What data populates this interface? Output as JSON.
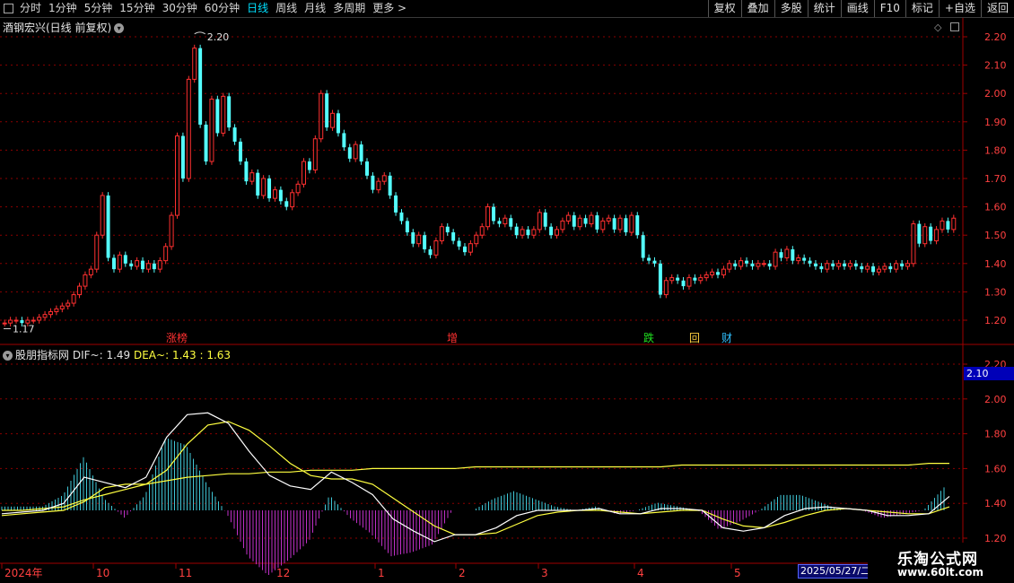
{
  "toolbar": {
    "periods": [
      "分时",
      "1分钟",
      "5分钟",
      "15分钟",
      "30分钟",
      "60分钟",
      "日线",
      "周线",
      "月线",
      "多周期",
      "更多"
    ],
    "active_period": "日线",
    "more_arrow": ">",
    "buttons": [
      "复权",
      "叠加",
      "多股",
      "统计",
      "画线",
      "F10",
      "标记",
      "+自选",
      "返回"
    ]
  },
  "main_panel": {
    "title": "酒钢宏兴(日线 前复权)",
    "high_label": "2.20",
    "low_label": "1.17",
    "events": [
      {
        "text": "涨榜",
        "color": "#ff3030"
      },
      {
        "text": "增",
        "color": "#ff3030"
      },
      {
        "text": "跌",
        "color": "#20e020"
      },
      {
        "text": "回",
        "color": "#ffd040"
      },
      {
        "text": "财",
        "color": "#30c0ff"
      }
    ]
  },
  "indicator_panel": {
    "title_prefix": "股朋指标网",
    "dif_label": "DIF~: ",
    "dif_value": "1.49",
    "dea_label": "DEA~: ",
    "dea_value": "1.43",
    "third_value": "1.63",
    "current_value": "2.10"
  },
  "chart_data": {
    "type": "candlestick",
    "price_axis": {
      "ticks": [
        "2.20",
        "2.10",
        "2.00",
        "1.90",
        "1.80",
        "1.70",
        "1.60",
        "1.50",
        "1.40",
        "1.30",
        "1.20"
      ],
      "range": [
        1.17,
        2.22
      ]
    },
    "indicator_axis": {
      "ticks": [
        "2.20",
        "2.00",
        "1.80",
        "1.60",
        "1.40",
        "1.20"
      ]
    },
    "x_axis": {
      "labels": [
        "2024年",
        "10",
        "11",
        "12",
        "1",
        "2",
        "3",
        "4",
        "5"
      ]
    },
    "selected_date": "2025/05/27/二",
    "candles": [
      {
        "o": 1.19,
        "c": 1.19
      },
      {
        "o": 1.19,
        "c": 1.2
      },
      {
        "o": 1.2,
        "c": 1.2
      },
      {
        "o": 1.2,
        "c": 1.19
      },
      {
        "o": 1.19,
        "c": 1.2
      },
      {
        "o": 1.2,
        "c": 1.2
      },
      {
        "o": 1.2,
        "c": 1.21
      },
      {
        "o": 1.21,
        "c": 1.22
      },
      {
        "o": 1.22,
        "c": 1.23
      },
      {
        "o": 1.23,
        "c": 1.24
      },
      {
        "o": 1.24,
        "c": 1.25
      },
      {
        "o": 1.25,
        "c": 1.26
      },
      {
        "o": 1.26,
        "c": 1.29
      },
      {
        "o": 1.29,
        "c": 1.32
      },
      {
        "o": 1.32,
        "c": 1.36
      },
      {
        "o": 1.36,
        "c": 1.38
      },
      {
        "o": 1.38,
        "c": 1.5
      },
      {
        "o": 1.5,
        "c": 1.64
      },
      {
        "o": 1.64,
        "c": 1.42
      },
      {
        "o": 1.42,
        "c": 1.38
      },
      {
        "o": 1.38,
        "c": 1.43
      },
      {
        "o": 1.43,
        "c": 1.4
      },
      {
        "o": 1.4,
        "c": 1.39
      },
      {
        "o": 1.39,
        "c": 1.41
      },
      {
        "o": 1.41,
        "c": 1.38
      },
      {
        "o": 1.38,
        "c": 1.4
      },
      {
        "o": 1.4,
        "c": 1.38
      },
      {
        "o": 1.38,
        "c": 1.41
      },
      {
        "o": 1.41,
        "c": 1.46
      },
      {
        "o": 1.46,
        "c": 1.57
      },
      {
        "o": 1.57,
        "c": 1.85
      },
      {
        "o": 1.85,
        "c": 1.7
      },
      {
        "o": 1.7,
        "c": 2.05
      },
      {
        "o": 2.05,
        "c": 2.16
      },
      {
        "o": 2.16,
        "c": 1.89
      },
      {
        "o": 1.89,
        "c": 1.76
      },
      {
        "o": 1.76,
        "c": 1.98
      },
      {
        "o": 1.98,
        "c": 1.86
      },
      {
        "o": 1.86,
        "c": 1.99
      },
      {
        "o": 1.99,
        "c": 1.88
      },
      {
        "o": 1.88,
        "c": 1.83
      },
      {
        "o": 1.83,
        "c": 1.76
      },
      {
        "o": 1.76,
        "c": 1.69
      },
      {
        "o": 1.69,
        "c": 1.72
      },
      {
        "o": 1.72,
        "c": 1.64
      },
      {
        "o": 1.64,
        "c": 1.7
      },
      {
        "o": 1.7,
        "c": 1.63
      },
      {
        "o": 1.63,
        "c": 1.66
      },
      {
        "o": 1.66,
        "c": 1.62
      },
      {
        "o": 1.62,
        "c": 1.6
      },
      {
        "o": 1.6,
        "c": 1.65
      },
      {
        "o": 1.65,
        "c": 1.68
      },
      {
        "o": 1.68,
        "c": 1.76
      },
      {
        "o": 1.76,
        "c": 1.73
      },
      {
        "o": 1.73,
        "c": 1.84
      },
      {
        "o": 1.84,
        "c": 2.0
      },
      {
        "o": 2.0,
        "c": 1.88
      },
      {
        "o": 1.88,
        "c": 1.93
      },
      {
        "o": 1.93,
        "c": 1.86
      },
      {
        "o": 1.86,
        "c": 1.81
      },
      {
        "o": 1.81,
        "c": 1.77
      },
      {
        "o": 1.77,
        "c": 1.82
      },
      {
        "o": 1.82,
        "c": 1.76
      },
      {
        "o": 1.76,
        "c": 1.71
      },
      {
        "o": 1.71,
        "c": 1.66
      },
      {
        "o": 1.66,
        "c": 1.69
      },
      {
        "o": 1.69,
        "c": 1.71
      },
      {
        "o": 1.71,
        "c": 1.64
      },
      {
        "o": 1.64,
        "c": 1.58
      },
      {
        "o": 1.58,
        "c": 1.55
      },
      {
        "o": 1.55,
        "c": 1.51
      },
      {
        "o": 1.51,
        "c": 1.47
      },
      {
        "o": 1.47,
        "c": 1.5
      },
      {
        "o": 1.5,
        "c": 1.45
      },
      {
        "o": 1.45,
        "c": 1.43
      },
      {
        "o": 1.43,
        "c": 1.48
      },
      {
        "o": 1.48,
        "c": 1.53
      },
      {
        "o": 1.53,
        "c": 1.51
      },
      {
        "o": 1.51,
        "c": 1.48
      },
      {
        "o": 1.48,
        "c": 1.46
      },
      {
        "o": 1.46,
        "c": 1.44
      },
      {
        "o": 1.44,
        "c": 1.47
      },
      {
        "o": 1.47,
        "c": 1.5
      },
      {
        "o": 1.5,
        "c": 1.53
      },
      {
        "o": 1.53,
        "c": 1.6
      },
      {
        "o": 1.6,
        "c": 1.55
      },
      {
        "o": 1.55,
        "c": 1.54
      },
      {
        "o": 1.54,
        "c": 1.56
      },
      {
        "o": 1.56,
        "c": 1.53
      },
      {
        "o": 1.53,
        "c": 1.5
      },
      {
        "o": 1.5,
        "c": 1.52
      },
      {
        "o": 1.52,
        "c": 1.5
      },
      {
        "o": 1.5,
        "c": 1.52
      },
      {
        "o": 1.52,
        "c": 1.58
      },
      {
        "o": 1.58,
        "c": 1.53
      },
      {
        "o": 1.53,
        "c": 1.5
      },
      {
        "o": 1.5,
        "c": 1.52
      },
      {
        "o": 1.52,
        "c": 1.55
      },
      {
        "o": 1.55,
        "c": 1.57
      },
      {
        "o": 1.57,
        "c": 1.53
      },
      {
        "o": 1.53,
        "c": 1.56
      },
      {
        "o": 1.56,
        "c": 1.54
      },
      {
        "o": 1.54,
        "c": 1.57
      },
      {
        "o": 1.57,
        "c": 1.52
      },
      {
        "o": 1.52,
        "c": 1.55
      },
      {
        "o": 1.55,
        "c": 1.56
      },
      {
        "o": 1.56,
        "c": 1.52
      },
      {
        "o": 1.52,
        "c": 1.56
      },
      {
        "o": 1.56,
        "c": 1.51
      },
      {
        "o": 1.51,
        "c": 1.57
      },
      {
        "o": 1.57,
        "c": 1.5
      },
      {
        "o": 1.5,
        "c": 1.42
      },
      {
        "o": 1.42,
        "c": 1.41
      },
      {
        "o": 1.41,
        "c": 1.4
      },
      {
        "o": 1.4,
        "c": 1.29
      },
      {
        "o": 1.29,
        "c": 1.34
      },
      {
        "o": 1.34,
        "c": 1.35
      },
      {
        "o": 1.35,
        "c": 1.34
      },
      {
        "o": 1.34,
        "c": 1.32
      },
      {
        "o": 1.32,
        "c": 1.35
      },
      {
        "o": 1.35,
        "c": 1.34
      },
      {
        "o": 1.34,
        "c": 1.35
      },
      {
        "o": 1.35,
        "c": 1.36
      },
      {
        "o": 1.36,
        "c": 1.37
      },
      {
        "o": 1.37,
        "c": 1.36
      },
      {
        "o": 1.36,
        "c": 1.38
      },
      {
        "o": 1.38,
        "c": 1.4
      },
      {
        "o": 1.4,
        "c": 1.39
      },
      {
        "o": 1.39,
        "c": 1.41
      },
      {
        "o": 1.41,
        "c": 1.4
      },
      {
        "o": 1.4,
        "c": 1.39
      },
      {
        "o": 1.39,
        "c": 1.4
      },
      {
        "o": 1.4,
        "c": 1.4
      },
      {
        "o": 1.4,
        "c": 1.39
      },
      {
        "o": 1.39,
        "c": 1.44
      },
      {
        "o": 1.44,
        "c": 1.42
      },
      {
        "o": 1.42,
        "c": 1.45
      },
      {
        "o": 1.45,
        "c": 1.41
      },
      {
        "o": 1.41,
        "c": 1.42
      },
      {
        "o": 1.42,
        "c": 1.41
      },
      {
        "o": 1.41,
        "c": 1.4
      },
      {
        "o": 1.4,
        "c": 1.39
      },
      {
        "o": 1.39,
        "c": 1.38
      },
      {
        "o": 1.38,
        "c": 1.4
      },
      {
        "o": 1.4,
        "c": 1.39
      },
      {
        "o": 1.39,
        "c": 1.4
      },
      {
        "o": 1.4,
        "c": 1.39
      },
      {
        "o": 1.39,
        "c": 1.4
      },
      {
        "o": 1.4,
        "c": 1.39
      },
      {
        "o": 1.39,
        "c": 1.38
      },
      {
        "o": 1.38,
        "c": 1.39
      },
      {
        "o": 1.39,
        "c": 1.37
      },
      {
        "o": 1.37,
        "c": 1.38
      },
      {
        "o": 1.38,
        "c": 1.39
      },
      {
        "o": 1.39,
        "c": 1.38
      },
      {
        "o": 1.38,
        "c": 1.4
      },
      {
        "o": 1.4,
        "c": 1.39
      },
      {
        "o": 1.39,
        "c": 1.4
      },
      {
        "o": 1.4,
        "c": 1.54
      },
      {
        "o": 1.54,
        "c": 1.47
      },
      {
        "o": 1.47,
        "c": 1.53
      },
      {
        "o": 1.53,
        "c": 1.48
      },
      {
        "o": 1.48,
        "c": 1.52
      },
      {
        "o": 1.52,
        "c": 1.55
      },
      {
        "o": 1.55,
        "c": 1.52
      },
      {
        "o": 1.52,
        "c": 1.56
      }
    ],
    "series": [
      {
        "name": "DIF~",
        "color": "#ffffff",
        "values": [
          1.34,
          1.35,
          1.36,
          1.4,
          1.55,
          1.52,
          1.49,
          1.55,
          1.78,
          1.91,
          1.92,
          1.86,
          1.7,
          1.56,
          1.5,
          1.48,
          1.58,
          1.52,
          1.45,
          1.31,
          1.24,
          1.18,
          1.22,
          1.22,
          1.26,
          1.33,
          1.36,
          1.36,
          1.36,
          1.37,
          1.34,
          1.34,
          1.37,
          1.37,
          1.36,
          1.26,
          1.24,
          1.26,
          1.33,
          1.37,
          1.38,
          1.37,
          1.36,
          1.33,
          1.33,
          1.34,
          1.44
        ]
      },
      {
        "name": "DEA~",
        "color": "#ffff40",
        "values": [
          1.33,
          1.34,
          1.35,
          1.36,
          1.41,
          1.49,
          1.51,
          1.51,
          1.59,
          1.74,
          1.85,
          1.87,
          1.82,
          1.73,
          1.63,
          1.56,
          1.54,
          1.54,
          1.51,
          1.43,
          1.35,
          1.27,
          1.22,
          1.22,
          1.23,
          1.28,
          1.33,
          1.35,
          1.36,
          1.36,
          1.35,
          1.34,
          1.35,
          1.36,
          1.36,
          1.31,
          1.27,
          1.26,
          1.29,
          1.33,
          1.36,
          1.37,
          1.36,
          1.35,
          1.34,
          1.34,
          1.38
        ]
      },
      {
        "name": "1.63",
        "color": "#ffff40",
        "values": [
          1.36,
          1.36,
          1.37,
          1.38,
          1.42,
          1.45,
          1.48,
          1.51,
          1.53,
          1.55,
          1.56,
          1.57,
          1.57,
          1.58,
          1.58,
          1.59,
          1.59,
          1.59,
          1.6,
          1.6,
          1.6,
          1.6,
          1.6,
          1.61,
          1.61,
          1.61,
          1.61,
          1.61,
          1.61,
          1.61,
          1.61,
          1.61,
          1.61,
          1.62,
          1.62,
          1.62,
          1.62,
          1.62,
          1.62,
          1.62,
          1.62,
          1.62,
          1.62,
          1.62,
          1.62,
          1.63,
          1.63
        ]
      }
    ]
  },
  "colors": {
    "up": "#ff3030",
    "down": "#54ffff",
    "grid": "#8b0000",
    "axis_text": "#ff4040"
  },
  "watermark": {
    "line1": "乐淘公式网",
    "line2": "www.60lt.com"
  }
}
